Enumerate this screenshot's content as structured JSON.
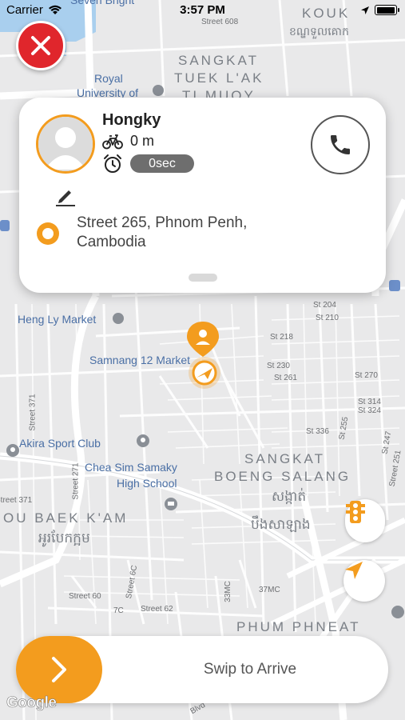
{
  "status_bar": {
    "carrier": "Carrier",
    "time": "3:57 PM",
    "battery_level": 1.0
  },
  "map": {
    "districts": [
      "SANGKAT",
      "TUEK L'AK",
      "TI MUOY",
      "KOUK",
      "SANGKAT",
      "BOENG SALANG",
      "OU BAEK K'AM",
      "PHUM PHNEAT"
    ],
    "districts_khmer": [
      "សង្កាត់",
      "បឹងសាឡាង",
      "អូរបែកក្អម",
      "ខណ្ឌទួលគោក"
    ],
    "pois": [
      "Royal",
      "University of",
      "Heng Ly Market",
      "Samnang 12 Market",
      "Akira Sport Club",
      "Chea Sim Samaky",
      "High School",
      "Seven Bright"
    ],
    "streets": [
      "Street 608",
      "St 204",
      "St 210",
      "St 218",
      "St 230",
      "St 261",
      "St 270",
      "St 314",
      "St 324",
      "St 336",
      "St 255",
      "St 247",
      "Street 251",
      "Street 371",
      "Street 271",
      "Street 371",
      "Street 60",
      "Street 6C",
      "Street 62",
      "33MC",
      "37MC",
      "7C",
      "Blvd"
    ]
  },
  "close_button": {
    "icon": "close-icon",
    "color": "#e0262c"
  },
  "card": {
    "driver_name": "Hongky",
    "distance": "0 m",
    "timer": "0sec",
    "destination": "Street 265, Phnom Penh, Cambodia",
    "accent_color": "#f39c1e"
  },
  "swipe": {
    "label": "Swip to Arrive"
  },
  "google_logo": "Google"
}
